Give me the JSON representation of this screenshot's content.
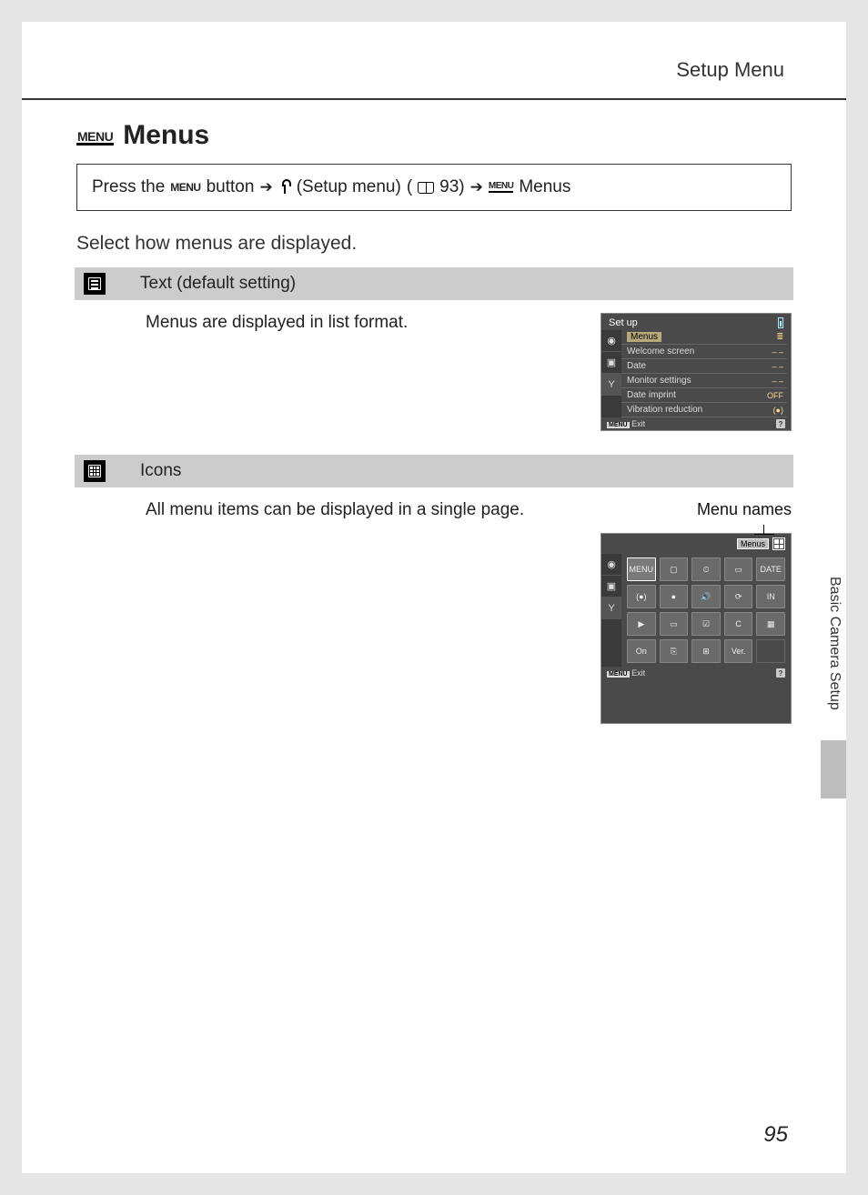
{
  "header": {
    "chapter": "Setup Menu"
  },
  "title": {
    "glyph_label": "MENU",
    "text": "Menus"
  },
  "nav": {
    "prefix": "Press the",
    "menu_word": "MENU",
    "button_word": "button",
    "setup_label": "(Setup menu)",
    "page_ref": "93)",
    "final": "Menus",
    "menu_small_glyph": "MENU"
  },
  "intro": "Select how menus are displayed.",
  "options": {
    "text": {
      "label": "Text (default setting)",
      "desc": "Menus are displayed in list format."
    },
    "icons": {
      "label": "Icons",
      "desc": "All menu items can be displayed in a single page.",
      "callout": "Menu names"
    }
  },
  "screenshot_list": {
    "title": "Set up",
    "rows": [
      {
        "label": "Menus",
        "value": "",
        "selected": true,
        "val_icon": "≣"
      },
      {
        "label": "Welcome screen",
        "value": "– –"
      },
      {
        "label": "Date",
        "value": "– –"
      },
      {
        "label": "Monitor settings",
        "value": "– –"
      },
      {
        "label": "Date imprint",
        "value": "OFF"
      },
      {
        "label": "Vibration reduction",
        "value": "(●)"
      }
    ],
    "exit_label": "Exit",
    "menu_badge": "MENU",
    "help": "?"
  },
  "screenshot_icons": {
    "title_label": "Menus",
    "exit_label": "Exit",
    "menu_badge": "MENU",
    "help": "?",
    "cells": [
      "MENU",
      "▢",
      "⏲",
      "▭",
      "DATE",
      "(●)",
      "●",
      "🔊",
      "⟳",
      "IN",
      "▶",
      "▭",
      "☑",
      "C",
      "▦",
      "On",
      "⎘",
      "⊞",
      "Ver.",
      ""
    ]
  },
  "side": {
    "label": "Basic Camera Setup"
  },
  "page_number": "95"
}
